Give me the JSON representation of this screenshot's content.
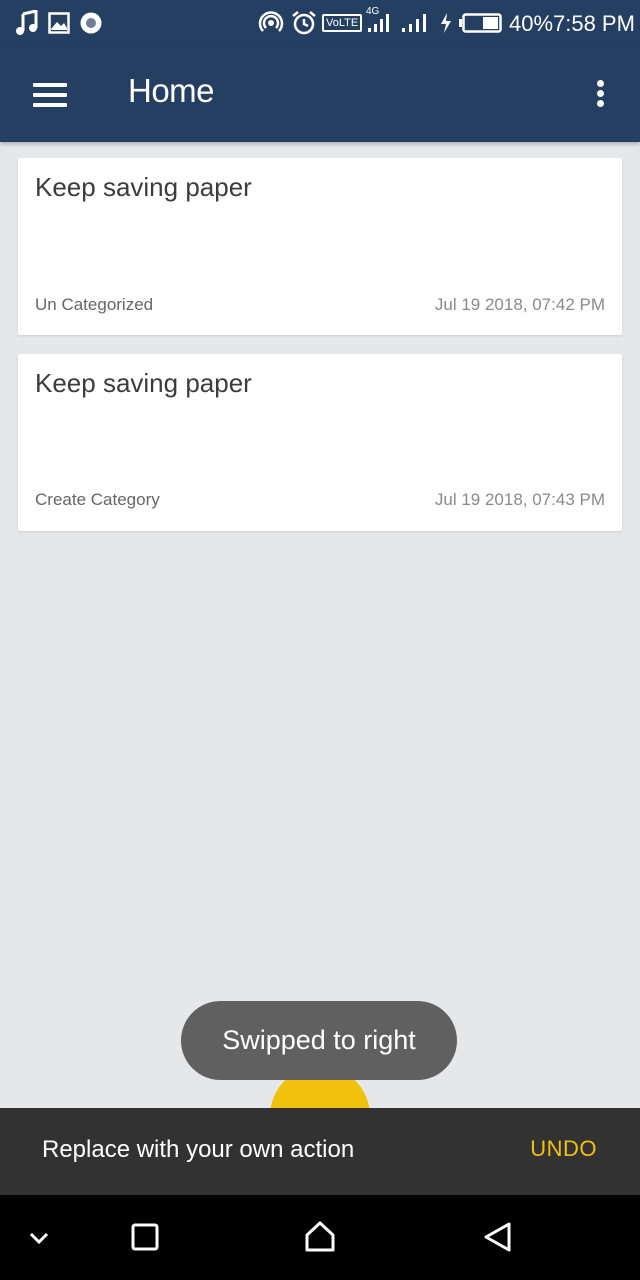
{
  "status_bar": {
    "left_icons": [
      "music-note-icon",
      "image-icon",
      "record-icon"
    ],
    "right_icons": [
      "hotspot-icon",
      "alarm-icon",
      "volte-icon",
      "signal-4g-icon",
      "signal-icon",
      "charging-icon",
      "battery-icon"
    ],
    "volte_label": "VoLTE",
    "network_label": "4G",
    "battery": "40%",
    "time": "7:58 PM"
  },
  "app_bar": {
    "title": "Home",
    "menu_icon": "hamburger-menu-icon",
    "overflow_icon": "more-vertical-icon"
  },
  "notes": [
    {
      "title": "Keep saving paper",
      "category": "Un Categorized",
      "date": "Jul 19 2018, 07:42 PM"
    },
    {
      "title": "Keep saving paper",
      "category": "Create Category",
      "date": "Jul 19 2018, 07:43 PM"
    }
  ],
  "toast": {
    "text": "Swipped to right"
  },
  "snackbar": {
    "text": "Replace with your own action",
    "action": "UNDO"
  },
  "nav_bar": {
    "buttons": [
      "chevron-down-icon",
      "recents-square-icon",
      "home-icon",
      "back-triangle-icon"
    ]
  },
  "colors": {
    "primary": "#253f63",
    "accent": "#f0c20e",
    "background": "#e6e7e9",
    "snackbar": "#323232",
    "toast": "#606060"
  }
}
